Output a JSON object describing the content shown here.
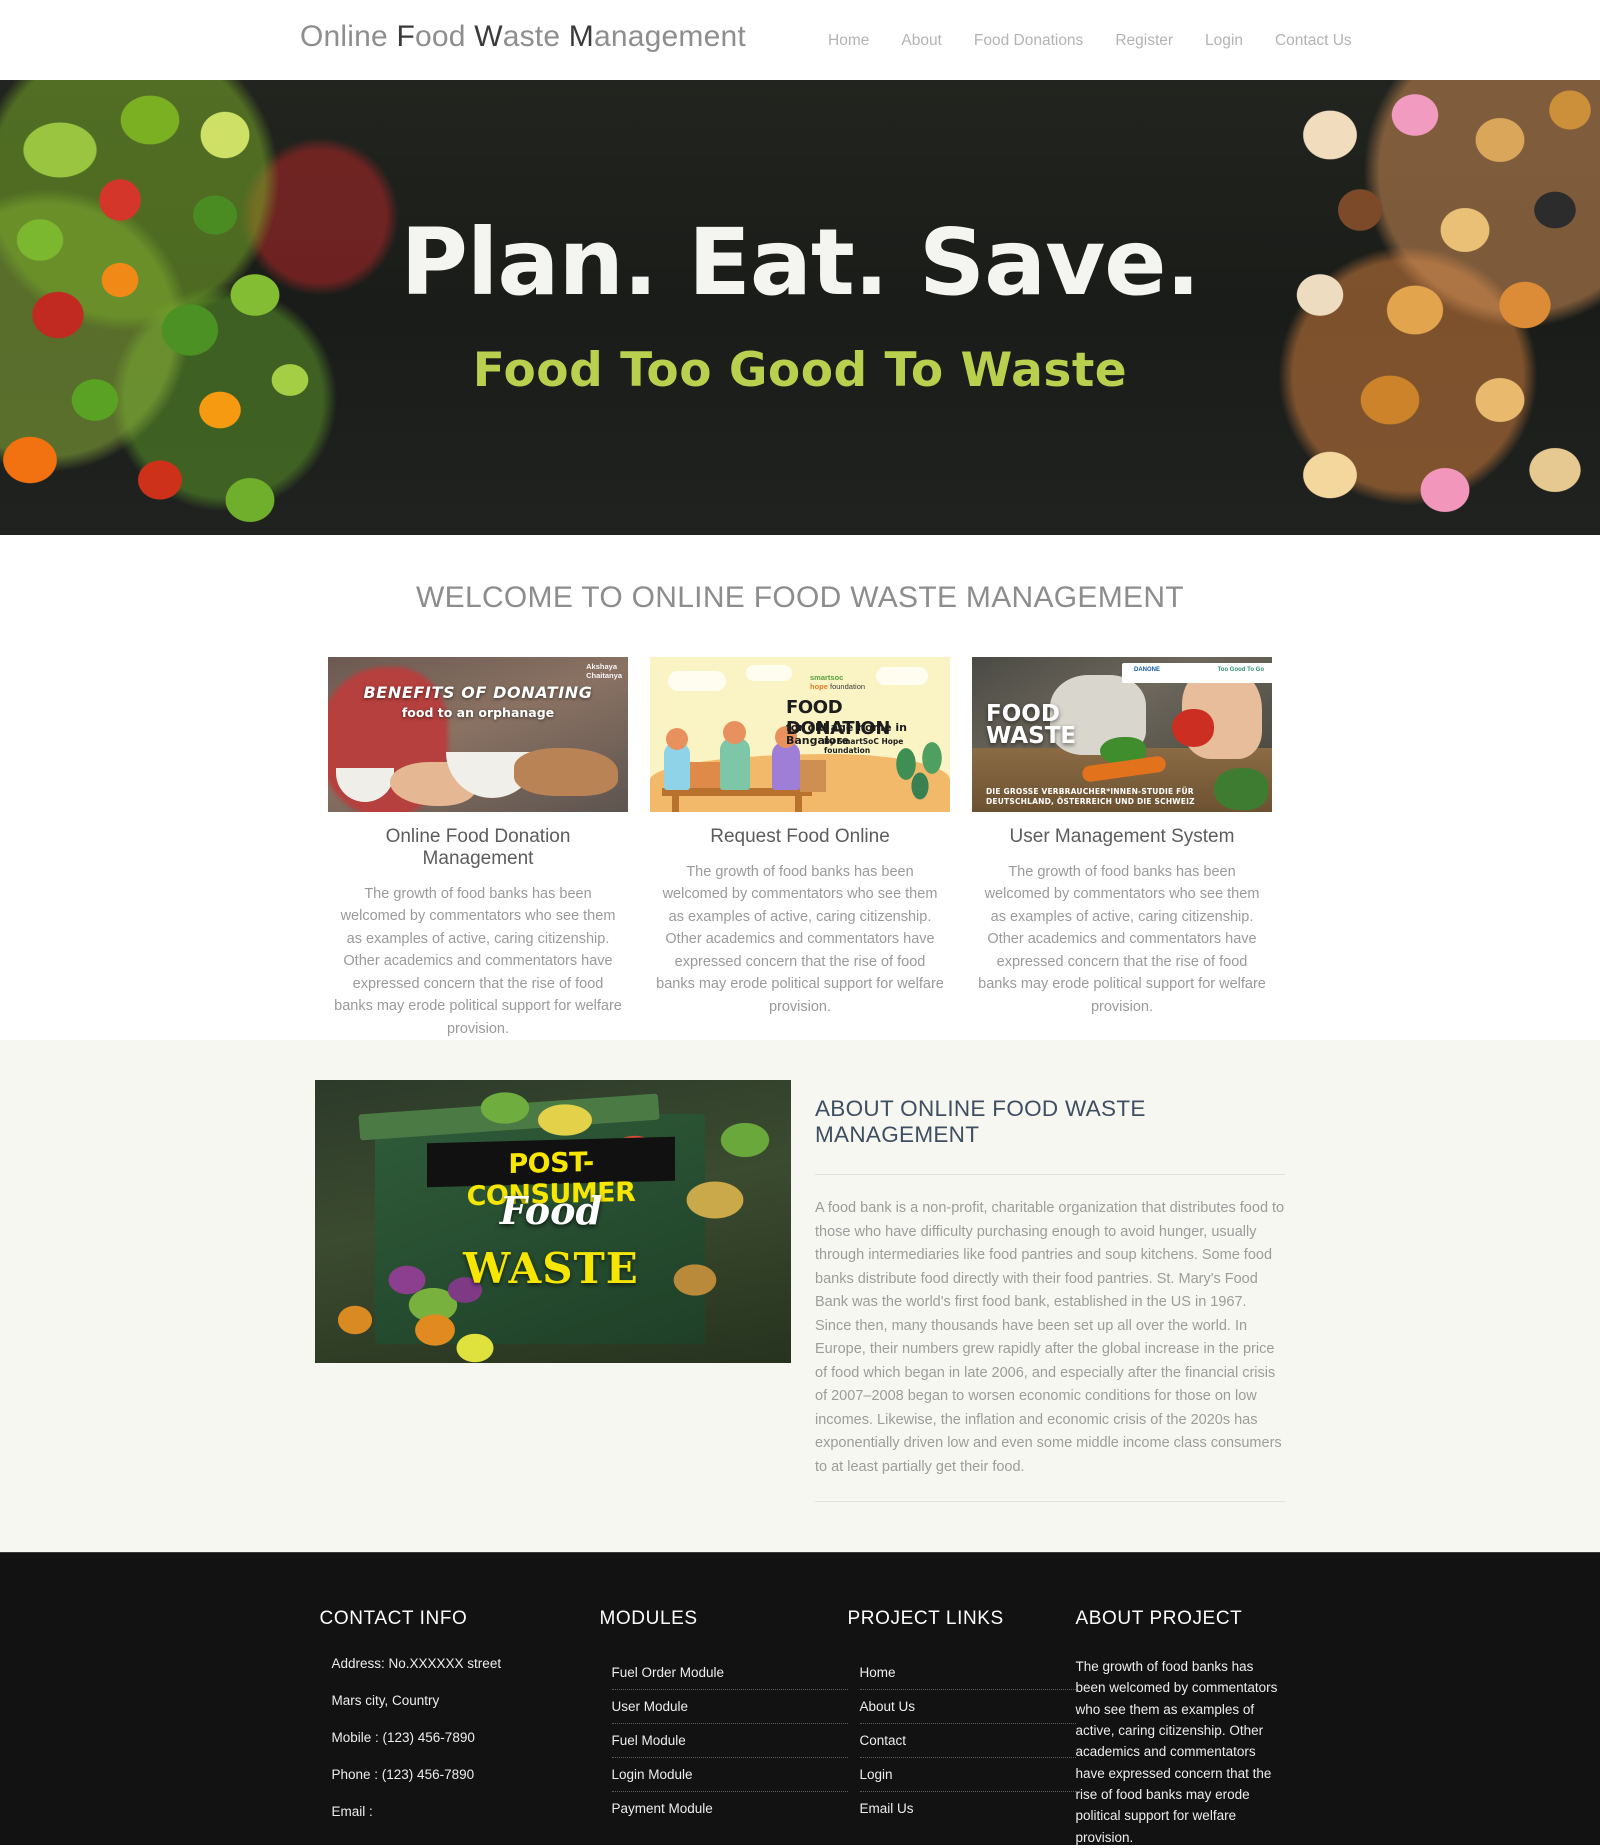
{
  "header": {
    "brand_parts": [
      {
        "text": "O",
        "style": "light"
      },
      {
        "text": "nline ",
        "style": "light"
      },
      {
        "text": "F",
        "style": "cap"
      },
      {
        "text": "ood ",
        "style": "light"
      },
      {
        "text": "W",
        "style": "cap"
      },
      {
        "text": "aste ",
        "style": "light"
      },
      {
        "text": "M",
        "style": "cap"
      },
      {
        "text": "anagement",
        "style": "light"
      }
    ],
    "brand_text": "Online Food Waste Management",
    "nav": [
      {
        "label": "Home"
      },
      {
        "label": "About"
      },
      {
        "label": "Food Donations"
      },
      {
        "label": "Register"
      },
      {
        "label": "Login"
      },
      {
        "label": "Contact Us"
      }
    ]
  },
  "hero": {
    "title": "Plan. Eat. Save.",
    "subtitle": "Food Too Good To Waste",
    "title_color": "#f4f4f0",
    "subtitle_color": "#b9cf4e",
    "background_color": "#1d1f1c"
  },
  "welcome": {
    "heading": "WELCOME TO ONLINE FOOD WASTE MANAGEMENT",
    "cards": [
      {
        "title": "Online Food Donation Management",
        "body": "The growth of food banks has been welcomed by commentators who see them as examples of active, caring citizenship. Other academics and commentators have expressed concern that the rise of food banks may erode political support for welfare provision.",
        "image_text": {
          "line1": "BENEFITS OF DONATING",
          "line2": "food to an orphanage",
          "logo_line1": "Akshaya",
          "logo_line2": "Chaitanya"
        }
      },
      {
        "title": "Request Food Online",
        "body": "The growth of food banks has been welcomed by commentators who see them as examples of active, caring citizenship. Other academics and commentators have expressed concern that the rise of food banks may erode political support for welfare provision.",
        "image_text": {
          "line1": "FOOD DONATION",
          "line2": "for old age home in Bangalore",
          "line3": "By SmartSoC Hope foundation",
          "logo_line1": "smartsoc",
          "logo_line2": "hope",
          "logo_line3": " foundation"
        }
      },
      {
        "title": "User Management System",
        "body": "The growth of food banks has been welcomed by commentators who see them as examples of active, caring citizenship. Other academics and commentators have expressed concern that the rise of food banks may erode political support for welfare provision.",
        "image_text": {
          "line1": "FOOD",
          "line2": "WASTE",
          "line3": "DIE GROSSE VERBRAUCHER*INNEN-STUDIE FÜR DEUTSCHLAND, ÖSTERREICH UND DIE SCHWEIZ",
          "badge_left": "DANONE",
          "badge_right": "Too Good To Go"
        }
      }
    ]
  },
  "about": {
    "heading": "ABOUT ONLINE FOOD WASTE MANAGEMENT",
    "body": "A food bank is a non-profit, charitable organization that distributes food to those who have difficulty purchasing enough to avoid hunger, usually through intermediaries like food pantries and soup kitchens. Some food banks distribute food directly with their food pantries. St. Mary's Food Bank was the world's first food bank, established in the US in 1967. Since then, many thousands have been set up all over the world. In Europe, their numbers grew rapidly after the global increase in the price of food which began in late 2006, and especially after the financial crisis of 2007–2008 began to worsen economic conditions for those on low incomes. Likewise, the inflation and economic crisis of the 2020s has exponentially driven low and even some middle income class consumers to at least partially get their food.",
    "image_text": {
      "line1": "POST-CONSUMER",
      "line2": "Food",
      "line3": "WASTE"
    },
    "background_color": "#f7f7f1",
    "heading_color": "#3f4f62"
  },
  "footer": {
    "background_color": "#121212",
    "contact": {
      "heading": "CONTACT INFO",
      "lines": [
        "Address: No.XXXXXX street",
        "Mars city, Country",
        "Mobile : (123) 456-7890",
        "Phone : (123) 456-7890",
        "Email :"
      ]
    },
    "modules": {
      "heading": "MODULES",
      "items": [
        {
          "label": "Fuel Order Module"
        },
        {
          "label": "User Module"
        },
        {
          "label": "Fuel Module"
        },
        {
          "label": "Login Module"
        },
        {
          "label": "Payment Module"
        }
      ]
    },
    "links": {
      "heading": "PROJECT LINKS",
      "items": [
        {
          "label": "Home"
        },
        {
          "label": "About Us"
        },
        {
          "label": "Contact"
        },
        {
          "label": "Login"
        },
        {
          "label": "Email Us"
        }
      ]
    },
    "about": {
      "heading": "ABOUT PROJECT",
      "body": "The growth of food banks has been welcomed by commentators who see them as examples of active, caring citizenship. Other academics and commentators have expressed concern that the rise of food banks may erode political support for welfare provision."
    }
  }
}
